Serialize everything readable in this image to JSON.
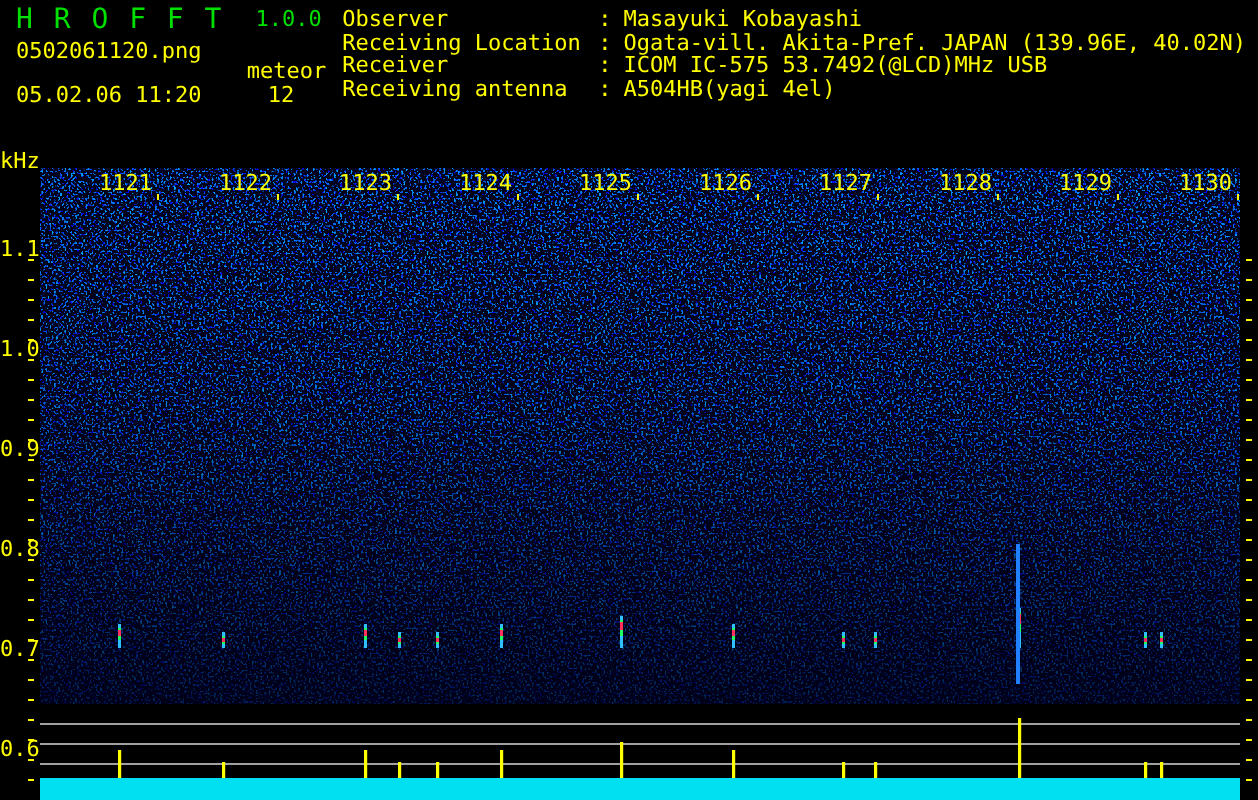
{
  "header": {
    "title": "H R O F F T",
    "version": "1.0.0",
    "filename": "0502061120.png",
    "datetime": "05.02.06 11:20",
    "meteor_label": "meteor",
    "meteor_count": "12"
  },
  "station": [
    {
      "label": "Observer",
      "separator": ":",
      "value": "Masayuki Kobayashi"
    },
    {
      "label": "Receiving Location",
      "separator": ":",
      "value": "Ogata-vill. Akita-Pref. JAPAN (139.96E, 40.02N)"
    },
    {
      "label": "Receiver",
      "separator": ":",
      "value": "ICOM IC-575 53.7492(@LCD)MHz USB"
    },
    {
      "label": "Receiving antenna",
      "separator": ":",
      "value": "A504HB(yagi 4el)"
    }
  ],
  "plot": {
    "unit": "kHz",
    "x_labels": [
      "1121",
      "1122",
      "1123",
      "1124",
      "1125",
      "1126",
      "1127",
      "1128",
      "1129",
      "1130"
    ],
    "y_labels": [
      "1.1",
      "1.0",
      "0.9",
      "0.8",
      "0.7",
      "0.6"
    ]
  }
}
